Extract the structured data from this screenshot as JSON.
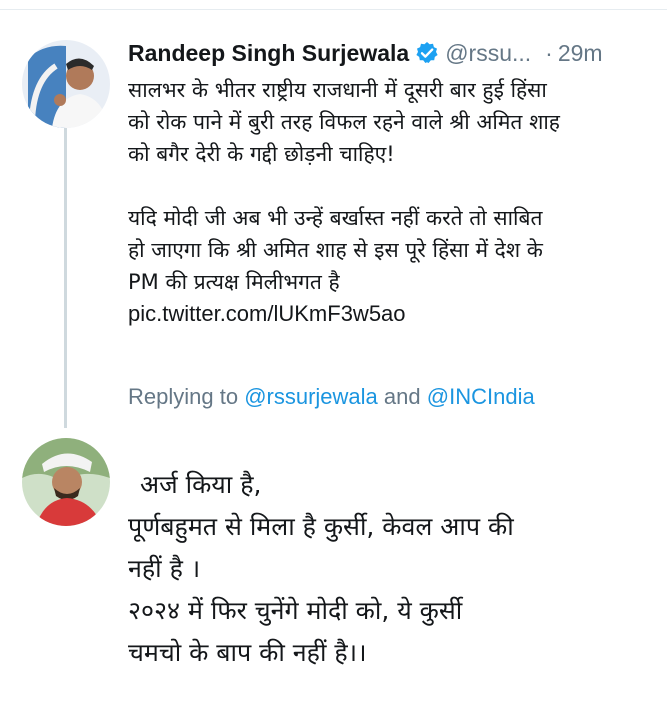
{
  "tweet": {
    "author_name": "Randeep Singh Surjewala",
    "handle": "@rssu...",
    "separator": "·",
    "time": "29m",
    "verified_icon": "verified-badge-icon",
    "body_lines_1": [
      "सालभर के भीतर राष्ट्रीय राजधानी में दूसरी बार हुई हिंसा",
      "को रोक पाने में बुरी तरह विफल रहने वाले श्री अमित शाह",
      "को बगैर देरी के गद्दी छोड़नी चाहिए!"
    ],
    "body_lines_2": [
      "यदि मोदी जी अब भी उन्हें बर्खास्त नहीं करते तो साबित",
      "हो जाएगा कि श्री अमित शाह से इस पूरे हिंसा में देश के",
      "PM की प्रत्यक्ष मिलीभगत है"
    ],
    "pic_link": "pic.twitter.com/lUKmF3w5ao",
    "replying_prefix": "Replying to",
    "reply_mention_1": "@rssurjewala",
    "reply_conjunction": "and",
    "reply_mention_2": "@INCIndia"
  },
  "reply": {
    "lines": [
      "अर्ज किया है,",
      "पूर्णबहुमत से मिला है कुर्सी, केवल आप की",
      "नहीं है ।",
      "२०२४ में फिर चुनेंगे मोदी को, ये कुर्सी",
      "चमचो के बाप की नहीं है।।"
    ]
  },
  "colors": {
    "link": "#1b95e0",
    "secondary_text": "#657786",
    "verified": "#1da1f2",
    "thread_line": "#cfd9de"
  }
}
